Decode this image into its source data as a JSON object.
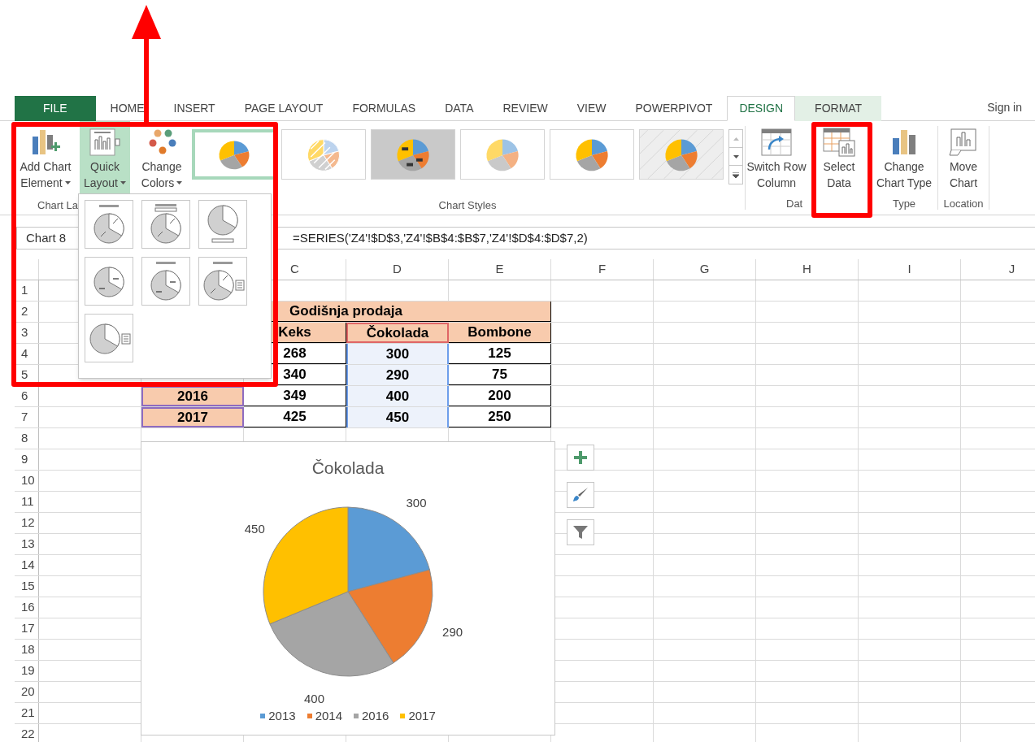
{
  "tabs": [
    {
      "label": "FILE",
      "kind": "file",
      "selected": false
    },
    {
      "label": "HOME",
      "kind": "plain",
      "selected": false
    },
    {
      "label": "INSERT",
      "kind": "plain",
      "selected": false
    },
    {
      "label": "PAGE LAYOUT",
      "kind": "plain",
      "selected": false
    },
    {
      "label": "FORMULAS",
      "kind": "plain",
      "selected": false
    },
    {
      "label": "DATA",
      "kind": "plain",
      "selected": false
    },
    {
      "label": "REVIEW",
      "kind": "plain",
      "selected": false
    },
    {
      "label": "VIEW",
      "kind": "plain",
      "selected": false
    },
    {
      "label": "POWERPIVOT",
      "kind": "plain",
      "selected": false
    },
    {
      "label": "DESIGN",
      "kind": "contextual",
      "selected": true
    },
    {
      "label": "FORMAT",
      "kind": "contextual",
      "selected": false
    }
  ],
  "sign_in": "Sign in",
  "ribbon": {
    "layouts_group": {
      "label": "Chart La",
      "buttons": [
        {
          "kind": "add_element",
          "lines": [
            "Add Chart",
            "Element"
          ],
          "dropdown": true,
          "pressed": false
        },
        {
          "kind": "quick_layout",
          "lines": [
            "Quick",
            "Layout"
          ],
          "dropdown": true,
          "pressed": true
        },
        {
          "kind": "colors",
          "lines": [
            "Change",
            "Colors"
          ],
          "dropdown": true,
          "pressed": false
        }
      ]
    },
    "styles_group": {
      "label": "Chart Styles",
      "styles": [
        {
          "kind": "plain",
          "selected": true
        },
        {
          "kind": "hatched",
          "selected": false
        },
        {
          "kind": "dark",
          "selected": false
        },
        {
          "kind": "soft",
          "selected": false
        },
        {
          "kind": "plain",
          "selected": false
        },
        {
          "kind": "striped",
          "selected": false
        }
      ]
    },
    "data_group": {
      "label": "Dat",
      "buttons": [
        {
          "kind": "switch",
          "lines": [
            "Switch Row",
            "Column"
          ]
        },
        {
          "kind": "select_data",
          "lines": [
            "Select",
            "Data"
          ]
        }
      ]
    },
    "type_group": {
      "label": "Type",
      "buttons": [
        {
          "kind": "chart_type",
          "lines": [
            "Change",
            "Chart Type"
          ]
        }
      ]
    },
    "location_group": {
      "label": "Location",
      "buttons": [
        {
          "kind": "move",
          "lines": [
            "Move",
            "Chart"
          ]
        }
      ]
    }
  },
  "quick_layout_menu": {
    "layouts": [
      {
        "kind": "titled"
      },
      {
        "kind": "banner"
      },
      {
        "kind": "footer"
      },
      {
        "kind": "labels"
      },
      {
        "kind": "titled_labels"
      },
      {
        "kind": "titled_legend"
      },
      {
        "kind": "legend"
      }
    ]
  },
  "formula_bar": {
    "name_box": "Chart 8",
    "formula": "=SERIES('Z4'!$D$3,'Z4'!$B$4:$B$7,'Z4'!$D$4:$D$7,2)"
  },
  "sheet": {
    "columns": [
      "C",
      "D",
      "E",
      "F",
      "G",
      "H",
      "I",
      "J"
    ],
    "rows": [
      {
        "label": "1"
      },
      {
        "label": "2",
        "title": {
          "text": "Godišnja prodaja",
          "kind": "label"
        }
      },
      {
        "label": "3",
        "C": {
          "text": "Keks",
          "kind": "label"
        },
        "D": {
          "text": "Čokolada",
          "kind": "label",
          "color": "#e06666"
        },
        "E": {
          "text": "Bombone",
          "kind": "label"
        }
      },
      {
        "label": "4",
        "C": {
          "text": "268",
          "kind": "value"
        },
        "D": {
          "text": "300",
          "kind": "picked"
        },
        "E": {
          "text": "125",
          "kind": "value"
        }
      },
      {
        "label": "5",
        "C": {
          "text": "340",
          "kind": "value"
        },
        "D": {
          "text": "290",
          "kind": "picked"
        },
        "E": {
          "text": "75",
          "kind": "value"
        }
      },
      {
        "label": "6",
        "B": {
          "text": "2016",
          "kind": "label",
          "color": "#8e6bbf"
        },
        "C": {
          "text": "349",
          "kind": "value"
        },
        "D": {
          "text": "400",
          "kind": "picked"
        },
        "E": {
          "text": "200",
          "kind": "value"
        }
      },
      {
        "label": "7",
        "B": {
          "text": "2017",
          "kind": "label",
          "color": "#8e6bbf"
        },
        "C": {
          "text": "425",
          "kind": "value"
        },
        "D": {
          "text": "450",
          "kind": "picked"
        },
        "E": {
          "text": "250",
          "kind": "value"
        }
      },
      {
        "label": "8"
      },
      {
        "label": "9"
      },
      {
        "label": "10"
      },
      {
        "label": "11"
      },
      {
        "label": "12"
      },
      {
        "label": "13"
      },
      {
        "label": "14"
      },
      {
        "label": "15"
      },
      {
        "label": "16"
      },
      {
        "label": "17"
      },
      {
        "label": "18"
      },
      {
        "label": "19"
      },
      {
        "label": "20"
      },
      {
        "label": "21"
      },
      {
        "label": "22"
      }
    ]
  },
  "chart": {
    "slices": [
      {
        "color": "#5b9bd5"
      },
      {
        "color": "#ed7d31"
      },
      {
        "color": "#a5a5a5"
      },
      {
        "color": "#ffc000"
      }
    ],
    "chart_data": {
      "type": "pie",
      "title": "Čokolada",
      "categories": [
        "2013",
        "2014",
        "2016",
        "2017"
      ],
      "series": [
        {
          "values": [
            300,
            290,
            400,
            450
          ]
        }
      ],
      "data_labels": true,
      "legend": "bottom"
    },
    "tools": [
      {
        "kind": "add"
      },
      {
        "kind": "style"
      },
      {
        "kind": "filter"
      }
    ]
  }
}
